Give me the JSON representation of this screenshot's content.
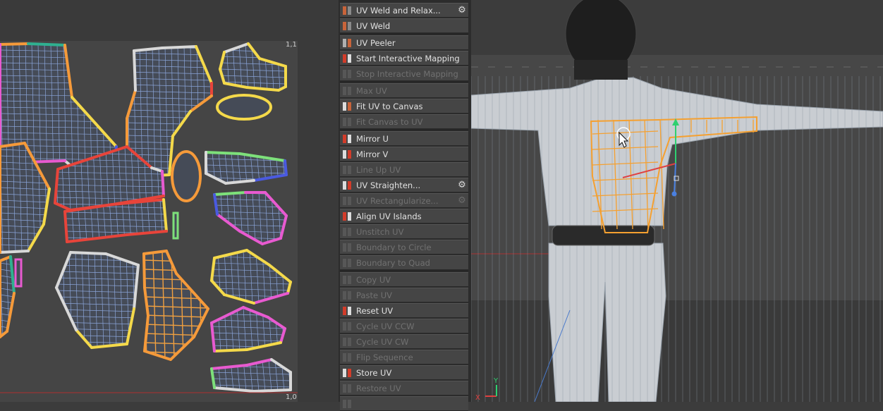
{
  "uv_editor": {
    "corner_top_right": "1,1",
    "corner_bottom_right": "1,0"
  },
  "commands": [
    {
      "label": "UV Weld and Relax...",
      "enabled": true,
      "gear": true,
      "icon": "weld-relax-icon"
    },
    {
      "label": "UV Weld",
      "enabled": true,
      "gear": false,
      "icon": "weld-icon"
    },
    {
      "label": "UV Peeler",
      "enabled": true,
      "gear": false,
      "icon": "peeler-icon"
    },
    {
      "label": "Start Interactive Mapping",
      "enabled": true,
      "gear": false,
      "icon": "start-mapping-icon"
    },
    {
      "label": "Stop Interactive Mapping",
      "enabled": false,
      "gear": false,
      "icon": "stop-mapping-icon"
    },
    {
      "label": "Max UV",
      "enabled": false,
      "gear": false,
      "icon": "max-uv-icon"
    },
    {
      "label": "Fit UV to Canvas",
      "enabled": true,
      "gear": false,
      "icon": "fit-uv-icon"
    },
    {
      "label": "Fit Canvas to UV",
      "enabled": false,
      "gear": false,
      "icon": "fit-canvas-icon"
    },
    {
      "label": "Mirror U",
      "enabled": true,
      "gear": false,
      "icon": "mirror-u-icon"
    },
    {
      "label": "Mirror V",
      "enabled": true,
      "gear": false,
      "icon": "mirror-v-icon"
    },
    {
      "label": "Line Up UV",
      "enabled": false,
      "gear": false,
      "icon": "line-up-icon"
    },
    {
      "label": "UV Straighten...",
      "enabled": true,
      "gear": true,
      "icon": "straighten-icon"
    },
    {
      "label": "UV Rectangularize...",
      "enabled": false,
      "gear": true,
      "icon": "rectangularize-icon"
    },
    {
      "label": "Align UV Islands",
      "enabled": true,
      "gear": false,
      "icon": "align-islands-icon"
    },
    {
      "label": "Unstitch UV",
      "enabled": false,
      "gear": false,
      "icon": "unstitch-icon"
    },
    {
      "label": "Boundary to Circle",
      "enabled": false,
      "gear": false,
      "icon": "boundary-circle-icon"
    },
    {
      "label": "Boundary to Quad",
      "enabled": false,
      "gear": false,
      "icon": "boundary-quad-icon"
    },
    {
      "label": "Copy UV",
      "enabled": false,
      "gear": false,
      "icon": "copy-uv-icon"
    },
    {
      "label": "Paste UV",
      "enabled": false,
      "gear": false,
      "icon": "paste-uv-icon"
    },
    {
      "label": "Reset UV",
      "enabled": true,
      "gear": false,
      "icon": "reset-uv-icon"
    },
    {
      "label": "Cycle UV CCW",
      "enabled": false,
      "gear": false,
      "icon": "cycle-ccw-icon"
    },
    {
      "label": "Cycle UV CW",
      "enabled": false,
      "gear": false,
      "icon": "cycle-cw-icon"
    },
    {
      "label": "Flip Sequence",
      "enabled": false,
      "gear": false,
      "icon": "flip-sequence-icon"
    },
    {
      "label": "Store UV",
      "enabled": true,
      "gear": false,
      "icon": "store-uv-icon"
    },
    {
      "label": "Restore UV",
      "enabled": false,
      "gear": false,
      "icon": "restore-uv-icon"
    },
    {
      "label": "",
      "enabled": false,
      "gear": false,
      "icon": "partial-icon"
    }
  ],
  "viewport": {
    "axis_x": "X",
    "axis_y": "Y"
  },
  "colors": {
    "enabled_text": "#e2e2e2",
    "disabled_text": "#717171",
    "selection": "#f5a030"
  }
}
